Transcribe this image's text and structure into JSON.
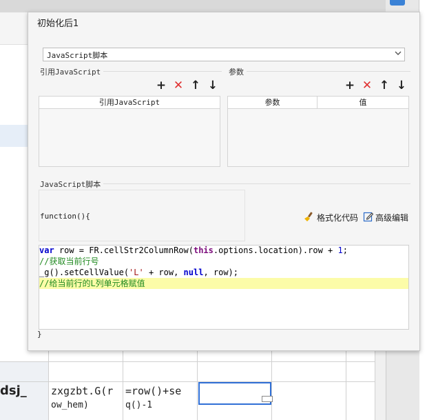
{
  "dialog": {
    "title": "初始化后1",
    "type_select": {
      "value": "JavaScript脚本"
    },
    "sections": {
      "ref_js_title": "引用JavaScript",
      "params_title": "参数",
      "script_title": "JavaScript脚本"
    },
    "toolbar_icons": [
      "plus-icon",
      "delete-x-icon",
      "arrow-up-icon",
      "arrow-down-icon"
    ],
    "ref_table": {
      "headers": [
        "引用JavaScript"
      ]
    },
    "params_table": {
      "headers": [
        "参数",
        "值"
      ]
    },
    "function_header": "function(){",
    "actions": {
      "format": "格式化代码",
      "advanced": "高级编辑"
    },
    "code": {
      "line1": {
        "t1": "var",
        "t2": " row = FR.cellStr2ColumnRow(",
        "t3": "this",
        "t4": ".options.location).row + ",
        "t5": "1",
        "t6": ";"
      },
      "line2": "//获取当前行号",
      "line3": {
        "t1": "_g().setCellValue(",
        "t2": "'L'",
        "t3": " + row, ",
        "t4": "null",
        "t5": ", row);"
      },
      "line4": "//给当前行的L列单元格赋值"
    },
    "closing": "}"
  },
  "spreadsheet": {
    "cell_left": "dsj_",
    "cell_formula_1": "zxgzbt.G(r",
    "cell_formula_1b": "ow_hem)",
    "cell_formula_2": "=row()+se",
    "cell_formula_2b": "q()-1"
  },
  "colors": {
    "accent": "#2f6fd6",
    "delete": "#e03030",
    "highlight": "#fcfca8",
    "keyword": "#0000cc",
    "comment": "#228b22"
  }
}
